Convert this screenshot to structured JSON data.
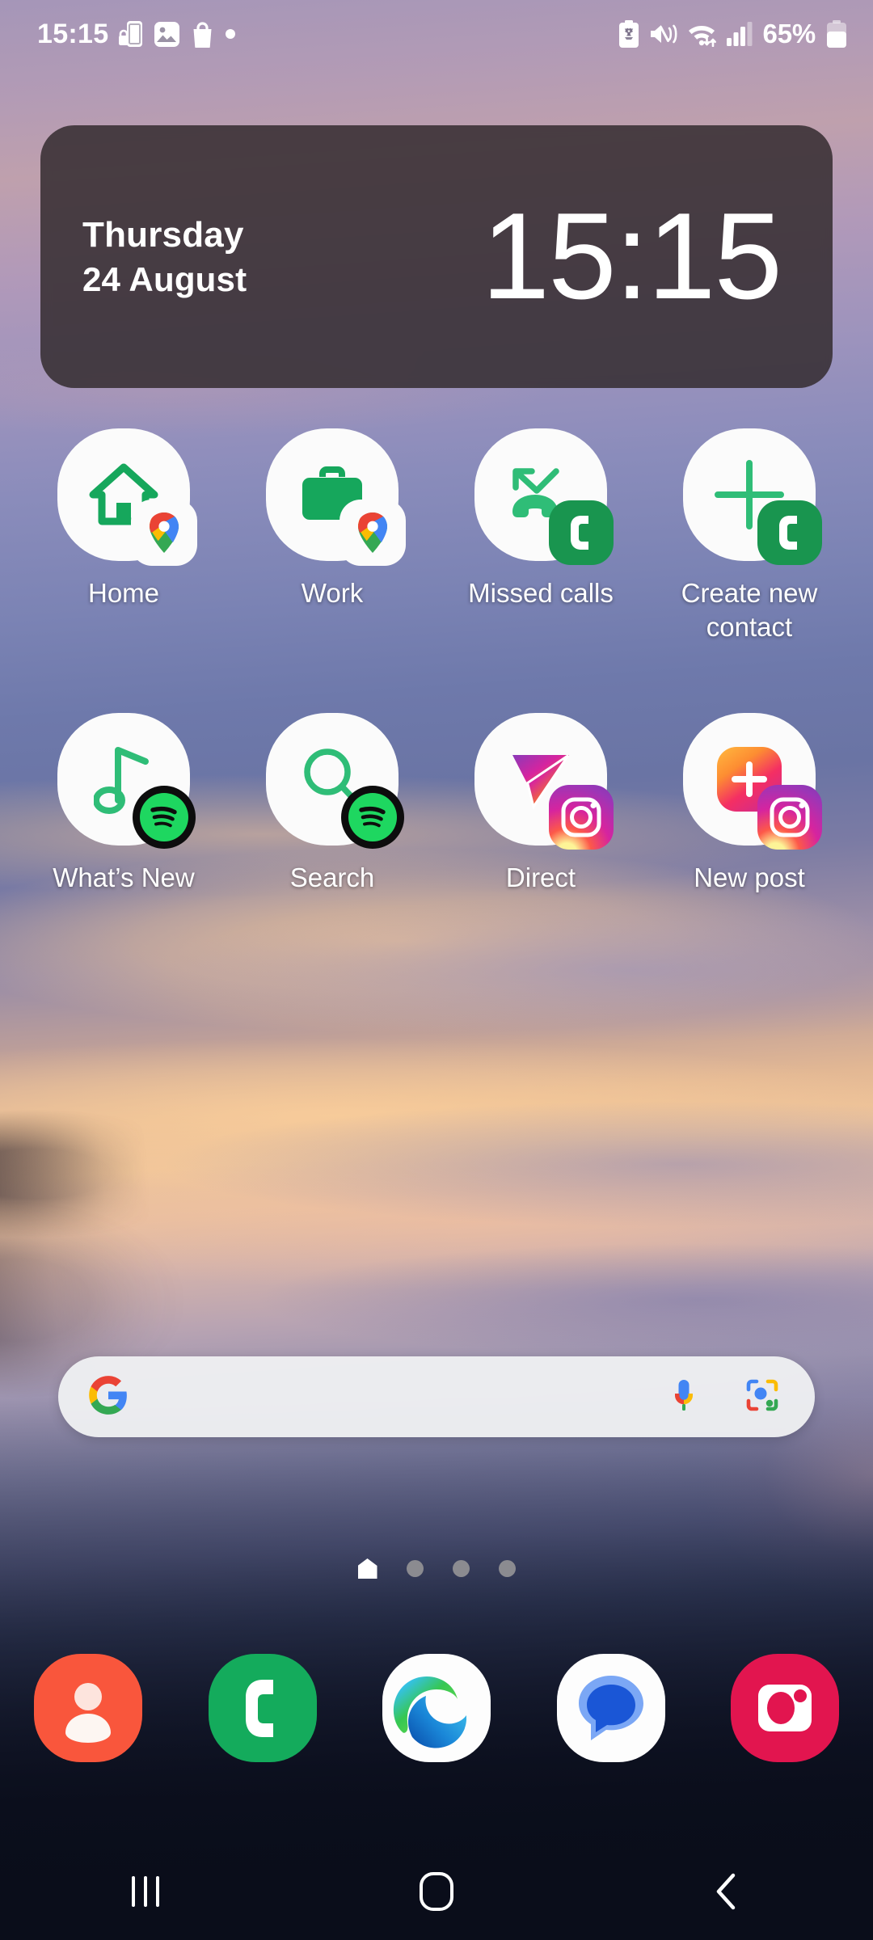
{
  "status_bar": {
    "clock": "15:15",
    "battery_percent": "65%",
    "left_icons": [
      "secure-phone-icon",
      "gallery-icon",
      "shopping-bag-icon",
      "dot-icon"
    ],
    "right_icons": [
      "battery-care-icon",
      "mute-vibrate-icon",
      "wifi-data-icon",
      "signal-bars-icon"
    ]
  },
  "clock_widget": {
    "weekday": "Thursday",
    "date": "24 August",
    "time": "15:15"
  },
  "app_grid": {
    "rows": [
      [
        {
          "label": "Home",
          "icon": "house-icon",
          "badge": "google-maps-icon"
        },
        {
          "label": "Work",
          "icon": "briefcase-icon",
          "badge": "google-maps-icon"
        },
        {
          "label": "Missed calls",
          "icon": "missed-call-icon",
          "badge": "samsung-contacts-icon"
        },
        {
          "label": "Create new contact",
          "icon": "plus-icon",
          "badge": "samsung-contacts-icon"
        }
      ],
      [
        {
          "label": "What’s New",
          "icon": "music-note-icon",
          "badge": "spotify-icon"
        },
        {
          "label": "Search",
          "icon": "magnifier-icon",
          "badge": "spotify-icon"
        },
        {
          "label": "Direct",
          "icon": "paper-plane-icon",
          "badge": "instagram-icon"
        },
        {
          "label": "New post",
          "icon": "new-post-icon",
          "badge": "instagram-icon"
        }
      ]
    ]
  },
  "search_bar": {
    "logo": "google-g-icon",
    "value": "",
    "placeholder": "",
    "mic": "microphone-icon",
    "lens": "google-lens-icon"
  },
  "page_indicator": {
    "total": 4,
    "current": 1,
    "current_shape": "home-page-icon"
  },
  "dock": {
    "items": [
      {
        "name": "Contacts",
        "icon": "contacts-app-icon"
      },
      {
        "name": "Phone",
        "icon": "phone-app-icon"
      },
      {
        "name": "Microsoft Edge",
        "icon": "edge-app-icon"
      },
      {
        "name": "Messages",
        "icon": "google-messages-app-icon"
      },
      {
        "name": "Camera",
        "icon": "camera-app-icon"
      }
    ]
  },
  "nav_bar": {
    "recents": "recents-icon",
    "home": "home-nav-icon",
    "back": "back-icon"
  },
  "colors": {
    "accent_green": "#16a75c",
    "widget_bg": "#342c30",
    "dock_bg": "#0a0d1a",
    "spotify_green": "#1ed760",
    "phone_green": "#1cab5d",
    "contacts_orange": "#f9563c",
    "camera_pink": "#e2154f"
  }
}
